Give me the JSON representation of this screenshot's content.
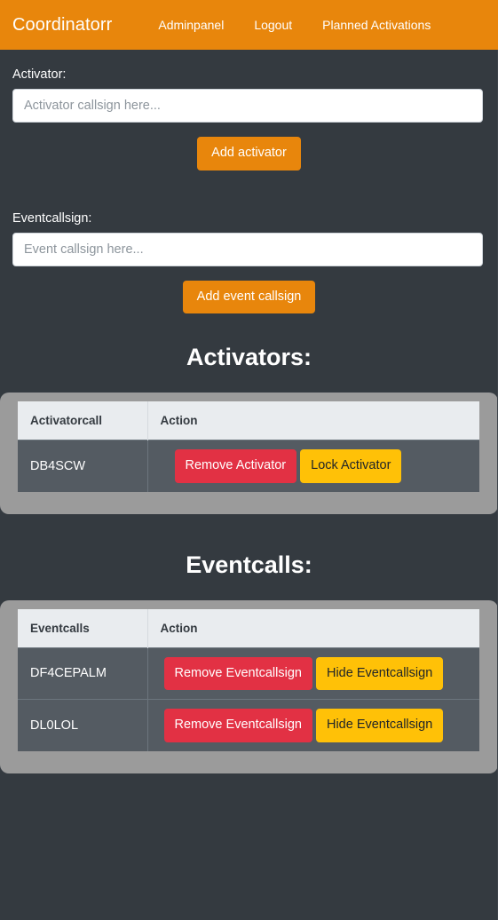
{
  "navbar": {
    "brand": "Coordinatorr",
    "links": [
      {
        "label": "Adminpanel"
      },
      {
        "label": "Logout"
      },
      {
        "label": "Planned Activations"
      }
    ]
  },
  "forms": {
    "activator": {
      "label": "Activator:",
      "placeholder": "Activator callsign here...",
      "value": "",
      "submit_label": "Add activator"
    },
    "eventcallsign": {
      "label": "Eventcallsign:",
      "placeholder": "Event callsign here...",
      "value": "",
      "submit_label": "Add event callsign"
    }
  },
  "activators_section": {
    "heading": "Activators:",
    "columns": [
      "Activatorcall",
      "Action"
    ],
    "rows": [
      {
        "call": "DB4SCW",
        "remove_label": "Remove Activator",
        "lock_label": "Lock Activator"
      }
    ]
  },
  "eventcalls_section": {
    "heading": "Eventcalls:",
    "columns": [
      "Eventcalls",
      "Action"
    ],
    "rows": [
      {
        "call": "DF4CEPALM",
        "remove_label": "Remove Eventcallsign",
        "hide_label": "Hide Eventcallsign"
      },
      {
        "call": "DL0LOL",
        "remove_label": "Remove Eventcallsign",
        "hide_label": "Hide Eventcallsign"
      }
    ]
  },
  "colors": {
    "brand_orange": "#e8860c",
    "page_background": "#343a40",
    "table_wrapper_gray": "#9b9b9b",
    "table_header_gray": "#e9ecef",
    "table_row_gray": "#545b62",
    "danger_red": "#e23144",
    "warning_yellow": "#ffc107"
  }
}
